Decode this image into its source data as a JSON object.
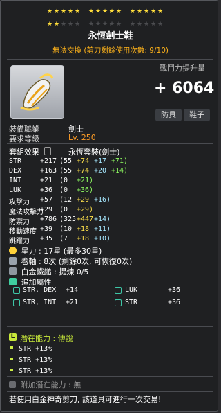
{
  "item": {
    "name": "永恆劍士鞋",
    "trade_note": "無法交換 (剪刀剩餘使用次數: 9/10)",
    "icon": "shoes-icon",
    "star_force": {
      "max": 30,
      "current": 17
    }
  },
  "power": {
    "label": "戰鬥力提升量",
    "value": "+ 6064"
  },
  "category": {
    "type_label": "防具",
    "slot_label": "鞋子"
  },
  "requirements": {
    "job_label": "裝備職業",
    "job_value": "劍士",
    "level_label": "要求等級",
    "level_value": "Lv. 250"
  },
  "set": {
    "label": "套組效果",
    "value": "永恆套裝(劍士)"
  },
  "stats": [
    {
      "name": "STR",
      "total": "+217",
      "base": "(55",
      "bonus": "+74",
      "scroll": "+17",
      "flame": "+71)"
    },
    {
      "name": "DEX",
      "total": "+163",
      "base": "(55",
      "bonus": "+74",
      "scroll": "+20",
      "flame": "+14)"
    },
    {
      "name": "INT",
      "total": "+21",
      "base": "(0",
      "bonus": "",
      "scroll": "",
      "flame": "+21)"
    },
    {
      "name": "LUK",
      "total": "+36",
      "base": "(0",
      "bonus": "",
      "scroll": "",
      "flame": "+36)"
    },
    {
      "name": "攻擊力",
      "total": "+57",
      "base": "(12",
      "bonus": "+29",
      "scroll": "+16)",
      "flame": ""
    },
    {
      "name": "魔法攻擊力",
      "total": "+29",
      "base": "(0",
      "bonus": "+29)",
      "scroll": "",
      "flame": ""
    },
    {
      "name": "防禦力",
      "total": "+786",
      "base": "(325",
      "bonus": "+447",
      "scroll": "+14)",
      "flame": ""
    },
    {
      "name": "移動速度",
      "total": "+39",
      "base": "(10",
      "bonus": "+18",
      "scroll": "+11)",
      "flame": ""
    },
    {
      "name": "跳躍力",
      "total": "+35",
      "base": "(7",
      "bonus": "+18",
      "scroll": "+10)",
      "flame": ""
    }
  ],
  "upgrades": {
    "star_label": "星力 : 17星 (最多30星)",
    "scroll_label": "卷軸 : 8次 (剩餘0次, 可恢復0次)",
    "hammer_label": "白金鐵鎚 : 提煉 0/5"
  },
  "flame": {
    "header": "追加屬性",
    "lines": [
      {
        "name": "STR, DEX",
        "value": "+14"
      },
      {
        "name": "LUK",
        "value": "+36"
      },
      {
        "name": "STR, INT",
        "value": "+21"
      },
      {
        "name": "STR",
        "value": "+36"
      }
    ]
  },
  "potential": {
    "badge": "L",
    "header": "潛在能力 : 傳說",
    "lines": [
      "STR +13%",
      "STR +13%",
      "STR +13%"
    ]
  },
  "bonus_potential": {
    "label": "附加潛在能力 : 無"
  },
  "footer": "若使用白金神奇剪刀, 該道具可進行一次交易!",
  "colors": {
    "background": "#1f2022",
    "trade": "#ffb31a",
    "star_on": "#ffdd3b",
    "level": "#ff9d26",
    "bonus_stat": "#ffe24b",
    "scroll_stat": "#a6e8ff",
    "flame_stat": "#8ffc61",
    "potential_header": "#c8e93a"
  }
}
